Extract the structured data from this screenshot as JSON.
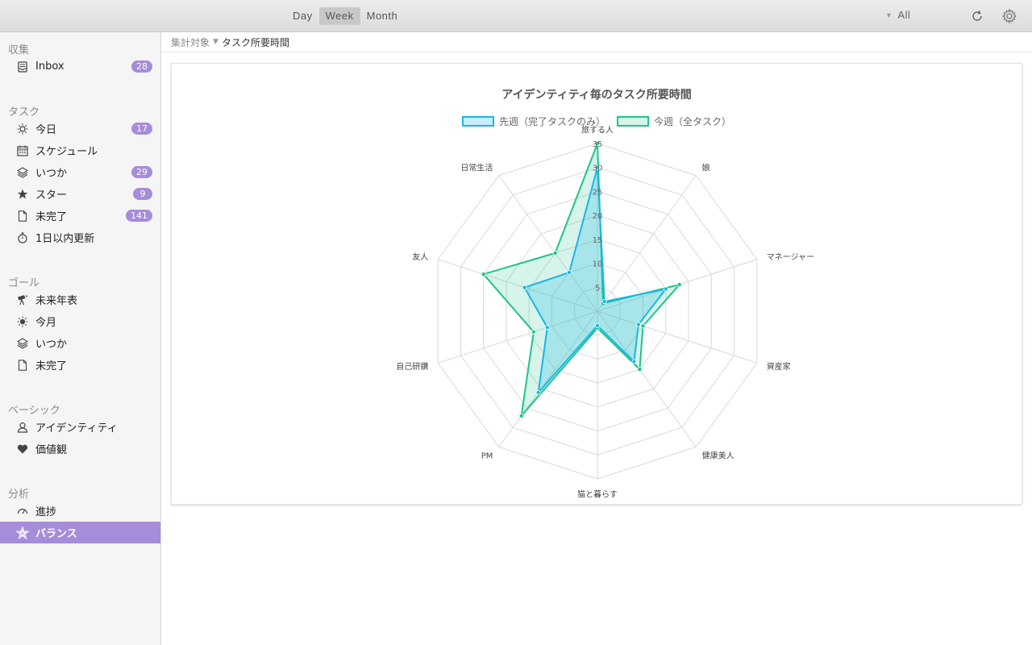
{
  "toolbar": {
    "ranges": [
      "Day",
      "Week",
      "Month"
    ],
    "active_range": "Week",
    "filter_label": "All",
    "refresh_icon": "refresh-icon",
    "settings_icon": "gear-icon"
  },
  "sidebar": {
    "sections": [
      {
        "title": "収集",
        "items": [
          {
            "label": "Inbox",
            "badge": "28",
            "icon": "inbox-icon"
          }
        ]
      },
      {
        "title": "タスク",
        "items": [
          {
            "label": "今日",
            "badge": "17",
            "icon": "sun-icon"
          },
          {
            "label": "スケジュール",
            "badge": "",
            "icon": "calendar-icon"
          },
          {
            "label": "いつか",
            "badge": "29",
            "icon": "layers-icon"
          },
          {
            "label": "スター",
            "badge": "9",
            "icon": "star-icon"
          },
          {
            "label": "未完了",
            "badge": "141",
            "icon": "document-icon"
          },
          {
            "label": "1日以内更新",
            "badge": "",
            "icon": "stopwatch-icon"
          }
        ]
      },
      {
        "title": "ゴール",
        "items": [
          {
            "label": "未来年表",
            "badge": "",
            "icon": "telescope-icon"
          },
          {
            "label": "今月",
            "badge": "",
            "icon": "sun-icon"
          },
          {
            "label": "いつか",
            "badge": "",
            "icon": "layers-icon"
          },
          {
            "label": "未完了",
            "badge": "",
            "icon": "document-icon"
          }
        ]
      },
      {
        "title": "ベーシック",
        "items": [
          {
            "label": "アイデンティティ",
            "badge": "",
            "icon": "person-icon"
          },
          {
            "label": "価値観",
            "badge": "",
            "icon": "heart-icon"
          }
        ]
      },
      {
        "title": "分析",
        "items": [
          {
            "label": "進捗",
            "badge": "",
            "icon": "gauge-icon"
          },
          {
            "label": "バランス",
            "badge": "",
            "icon": "radar-icon",
            "selected": true
          }
        ]
      }
    ]
  },
  "breadcrumb": {
    "label": "集計対象",
    "value": "タスク所要時間"
  },
  "chart_data": {
    "type": "radar",
    "title": "アイデンティティ毎のタスク所要時間",
    "categories": [
      "旅する人",
      "娘",
      "マネージャー",
      "資産家",
      "健康美人",
      "猫と暮らす",
      "PM",
      "自己研鑽",
      "友人",
      "日常生活"
    ],
    "rlim": [
      0,
      35
    ],
    "ticks": [
      5,
      10,
      15,
      20,
      25,
      30,
      35
    ],
    "grid": true,
    "legend_position": "top",
    "series": [
      {
        "name": "先週（完了タスクのみ）",
        "color": "#1ab6e8",
        "fill": "rgba(26,182,232,0.25)",
        "values": [
          30,
          2.5,
          15,
          9,
          13,
          3,
          21,
          11,
          16,
          10
        ]
      },
      {
        "name": "今週（全タスク）",
        "color": "#1fc48a",
        "fill": "rgba(31,196,138,0.18)",
        "values": [
          35,
          2,
          18,
          10,
          15,
          3.5,
          27,
          14,
          25,
          15
        ]
      }
    ]
  }
}
